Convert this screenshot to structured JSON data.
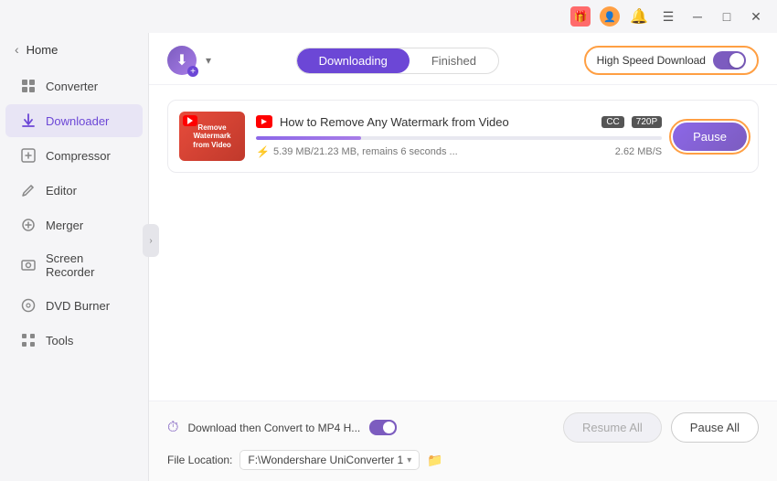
{
  "titlebar": {
    "icons": [
      "gift",
      "user",
      "bell",
      "menu",
      "minimize",
      "maximize",
      "close"
    ]
  },
  "sidebar": {
    "back_label": "Home",
    "items": [
      {
        "id": "converter",
        "label": "Converter",
        "icon": "⊞"
      },
      {
        "id": "downloader",
        "label": "Downloader",
        "icon": "↓",
        "active": true
      },
      {
        "id": "compressor",
        "label": "Compressor",
        "icon": "⊡"
      },
      {
        "id": "editor",
        "label": "Editor",
        "icon": "✂"
      },
      {
        "id": "merger",
        "label": "Merger",
        "icon": "⊕"
      },
      {
        "id": "screen-recorder",
        "label": "Screen Recorder",
        "icon": "⊙"
      },
      {
        "id": "dvd-burner",
        "label": "DVD Burner",
        "icon": "◉"
      },
      {
        "id": "tools",
        "label": "Tools",
        "icon": "⊞"
      }
    ]
  },
  "header": {
    "tab_downloading": "Downloading",
    "tab_finished": "Finished",
    "speed_label": "High Speed Download"
  },
  "download_item": {
    "title": "How to Remove Any Watermark from Video",
    "badge_cc": "CC",
    "badge_quality": "720P",
    "progress_percent": 26,
    "meta_size": "5.39 MB/21.23 MB, remains 6 seconds ...",
    "meta_speed": "2.62 MB/S",
    "pause_btn_label": "Pause",
    "thumb_text": "Remove\nWatermark\nfrom Video"
  },
  "footer": {
    "convert_label": "Download then Convert to MP4 H...",
    "resume_all_label": "Resume All",
    "pause_all_label": "Pause All",
    "location_label": "File Location:",
    "location_value": "F:\\Wondershare UniConverter 1",
    "location_placeholder": "F:\\Wondershare UniConverter 1"
  }
}
